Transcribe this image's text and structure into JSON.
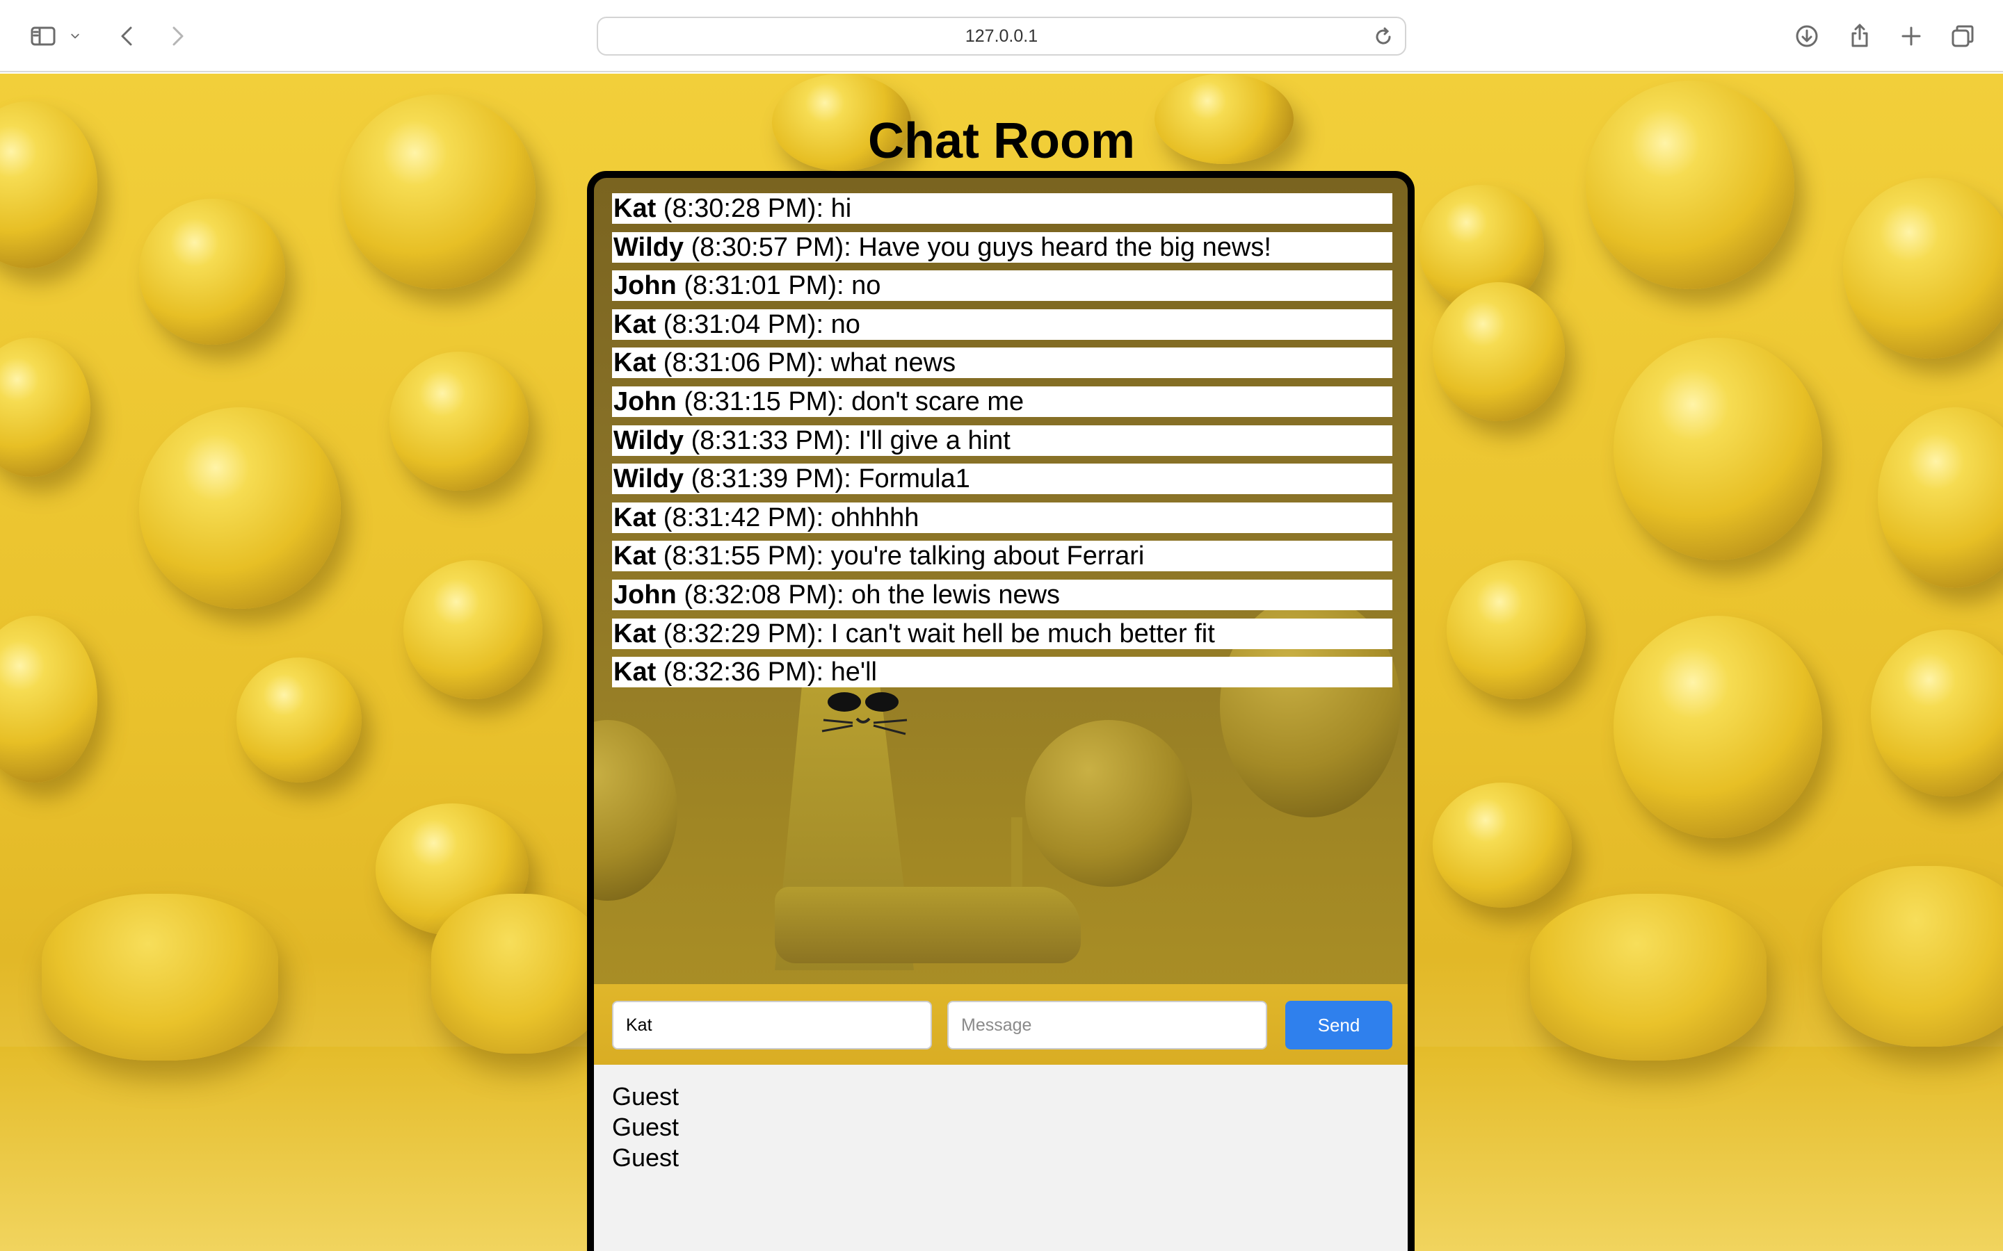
{
  "browser": {
    "url": "127.0.0.1"
  },
  "page": {
    "title": "Chat Room"
  },
  "messages": [
    {
      "user": "Kat",
      "time": "(8:30:28 PM): ",
      "text": "hi"
    },
    {
      "user": "Wildy",
      "time": "(8:30:57 PM): ",
      "text": "Have you guys heard the big news!"
    },
    {
      "user": "John",
      "time": "(8:31:01 PM): ",
      "text": "no"
    },
    {
      "user": "Kat",
      "time": "(8:31:04 PM): ",
      "text": "no"
    },
    {
      "user": "Kat",
      "time": "(8:31:06 PM): ",
      "text": "what news"
    },
    {
      "user": "John",
      "time": "(8:31:15 PM): ",
      "text": "don't scare me"
    },
    {
      "user": "Wildy",
      "time": "(8:31:33 PM): ",
      "text": "I'll give a hint"
    },
    {
      "user": "Wildy",
      "time": "(8:31:39 PM): ",
      "text": "Formula1"
    },
    {
      "user": "Kat",
      "time": "(8:31:42 PM): ",
      "text": "ohhhhh"
    },
    {
      "user": "Kat",
      "time": "(8:31:55 PM): ",
      "text": "you're talking about Ferrari"
    },
    {
      "user": "John",
      "time": "(8:32:08 PM): ",
      "text": "oh the lewis news"
    },
    {
      "user": "Kat",
      "time": "(8:32:29 PM): ",
      "text": "I can't wait hell be much better fit"
    },
    {
      "user": "Kat",
      "time": "(8:32:36 PM): ",
      "text": "he'll"
    }
  ],
  "form": {
    "username_value": "Kat",
    "message_placeholder": "Message",
    "send_label": "Send"
  },
  "users": [
    "Guest",
    "Guest",
    "Guest"
  ],
  "colors": {
    "background": "#f0cd3a",
    "send_button": "#2f80ed",
    "users_panel": "#f2f2f2",
    "border": "#000000"
  },
  "icons": {
    "sidebar": "sidebar-icon",
    "chevron": "chevron-down-icon",
    "back": "back-arrow-icon",
    "forward": "forward-arrow-icon",
    "reload": "reload-icon",
    "download": "download-icon",
    "share": "share-icon",
    "new_tab": "plus-icon",
    "tabs": "tab-overview-icon"
  }
}
